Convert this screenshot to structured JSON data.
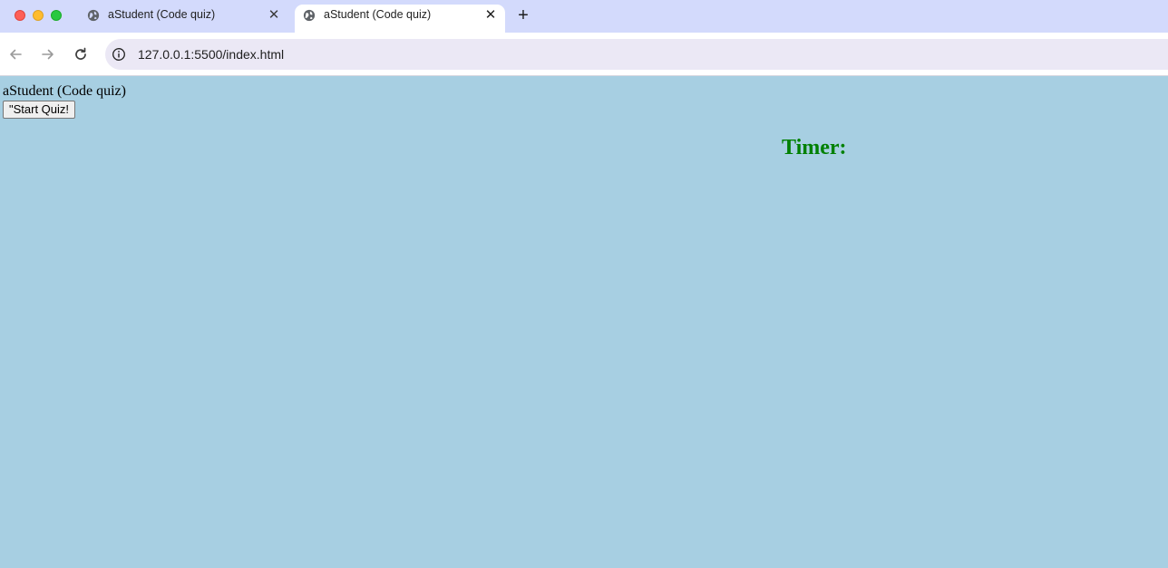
{
  "browser": {
    "tabs": [
      {
        "title": "aStudent (Code quiz)",
        "active": false,
        "icon": "globe-icon",
        "close": "✕"
      },
      {
        "title": "aStudent (Code quiz)",
        "active": true,
        "icon": "globe-icon",
        "close": "✕"
      }
    ],
    "new_tab_label": "+",
    "address": {
      "url": "127.0.0.1:5500/index.html",
      "icon": "info-icon"
    },
    "nav": {
      "back_icon": "arrow-left-icon",
      "forward_icon": "arrow-right-icon",
      "reload_icon": "reload-icon"
    },
    "colors": {
      "tab_strip": "#d3dafc",
      "page_background": "#a7cfe2",
      "omnibox": "#ebe8f5"
    }
  },
  "page": {
    "title_text": "aStudent (Code quiz)",
    "start_button_label": "\"Start Quiz!",
    "timer_label": "Timer:",
    "timer_color": "#008000"
  }
}
